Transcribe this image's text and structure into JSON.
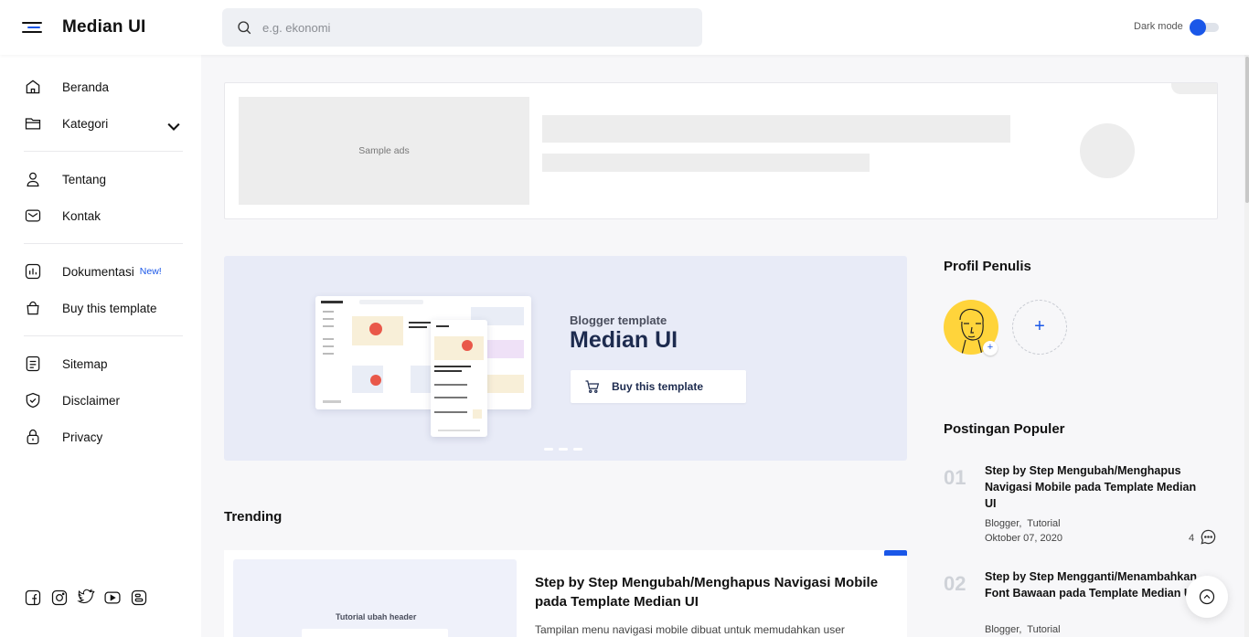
{
  "header": {
    "brand": "Median UI",
    "search_placeholder": "e.g. ekonomi",
    "dark_mode_label": "Dark mode",
    "dark_mode_on": false
  },
  "sidebar": {
    "items": [
      {
        "label": "Beranda",
        "icon": "home-icon"
      },
      {
        "label": "Kategori",
        "icon": "folder-icon"
      },
      {
        "label": "Tentang",
        "icon": "user-icon"
      },
      {
        "label": "Kontak",
        "icon": "mail-icon"
      },
      {
        "label": "Dokumentasi",
        "icon": "chart-doc-icon",
        "badge": "New!"
      },
      {
        "label": "Buy this template",
        "icon": "shopping-bag-icon"
      },
      {
        "label": "Sitemap",
        "icon": "list-doc-icon"
      },
      {
        "label": "Disclaimer",
        "icon": "shield-check-icon"
      },
      {
        "label": "Privacy",
        "icon": "lock-icon"
      }
    ],
    "socials": [
      "facebook-icon",
      "instagram-icon",
      "twitter-icon",
      "youtube-icon",
      "blogger-icon"
    ]
  },
  "ads": {
    "label": "Sample ads"
  },
  "banner": {
    "subtitle": "Blogger template",
    "title": "Median UI",
    "button": "Buy this template"
  },
  "trending": {
    "heading": "Trending",
    "thumb_text": "Tutorial ubah header",
    "title": "Step by Step Mengubah/Menghapus Navigasi Mobile pada Template Median UI",
    "snippet": "Tampilan menu navigasi mobile dibuat untuk memudahkan user"
  },
  "profile": {
    "heading": "Profil Penulis",
    "add_symbol": "+"
  },
  "popular": {
    "heading": "Postingan Populer",
    "posts": [
      {
        "num": "01",
        "title": "Step by Step Mengubah/Menghapus Navigasi Mobile pada Template Median UI",
        "labels": [
          "Blogger",
          "Tutorial"
        ],
        "date": "Oktober 07, 2020",
        "comments": "4"
      },
      {
        "num": "02",
        "title": "Step by Step Mengganti/Menambahkan Font Bawaan pada Template Median UI",
        "labels": [
          "Blogger",
          "Tutorial"
        ]
      }
    ]
  },
  "colors": {
    "accent": "#1a57e8",
    "banner_bg": "#e8ebf7",
    "avatar_bg": "#ffd43b"
  }
}
